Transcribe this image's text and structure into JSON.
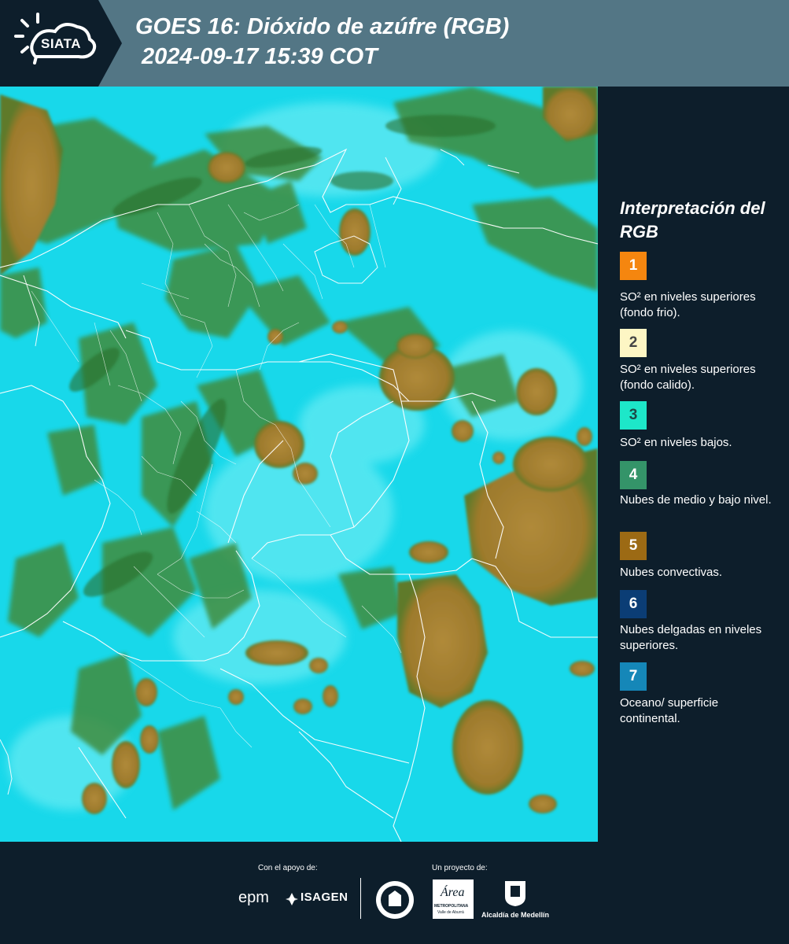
{
  "header": {
    "logo_text": "SIATA",
    "title": "GOES 16: Dióxido de azúfre (RGB)",
    "subtitle": "2024-09-17 15:39 COT"
  },
  "legend": {
    "title": "Interpretación del RGB",
    "items": [
      {
        "number": "1",
        "color": "#f5860f",
        "text_color": "#ffffff",
        "label": "SO² en niveles superiores (fondo frio)."
      },
      {
        "number": "2",
        "color": "#fdf6c4",
        "text_color": "#444444",
        "label": "SO² en niveles superiores (fondo calido)."
      },
      {
        "number": "3",
        "color": "#1de7c9",
        "text_color": "#1d4a46",
        "label": "SO² en niveles bajos."
      },
      {
        "number": "4",
        "color": "#349469",
        "text_color": "#ffffff",
        "label": "Nubes de medio y bajo nivel."
      },
      {
        "number": "5",
        "color": "#9c6a14",
        "text_color": "#ffffff",
        "label": "Nubes convectivas."
      },
      {
        "number": "6",
        "color": "#0b3d75",
        "text_color": "#ffffff",
        "label": "Nubes delgadas en niveles superiores."
      },
      {
        "number": "7",
        "color": "#1587b8",
        "text_color": "#ffffff",
        "label": "Oceano/ superficie continental."
      }
    ]
  },
  "footer": {
    "support_label": "Con el apoyo de:",
    "project_label": "Un proyecto de:",
    "epm": "epm",
    "isagen": "ISAGEN",
    "area_name": "Área",
    "area_sub": "METROPOLITANA",
    "area_sub2": "Valle de Aburrá",
    "alcaldia": "Alcaldía de Medellín"
  },
  "colors": {
    "header_bg": "#537685",
    "dark_bg": "#0d1e2b",
    "sea_cyan": "#12dcef",
    "convective": "#a0782a",
    "low_cloud_green": "#3e8a3a"
  }
}
